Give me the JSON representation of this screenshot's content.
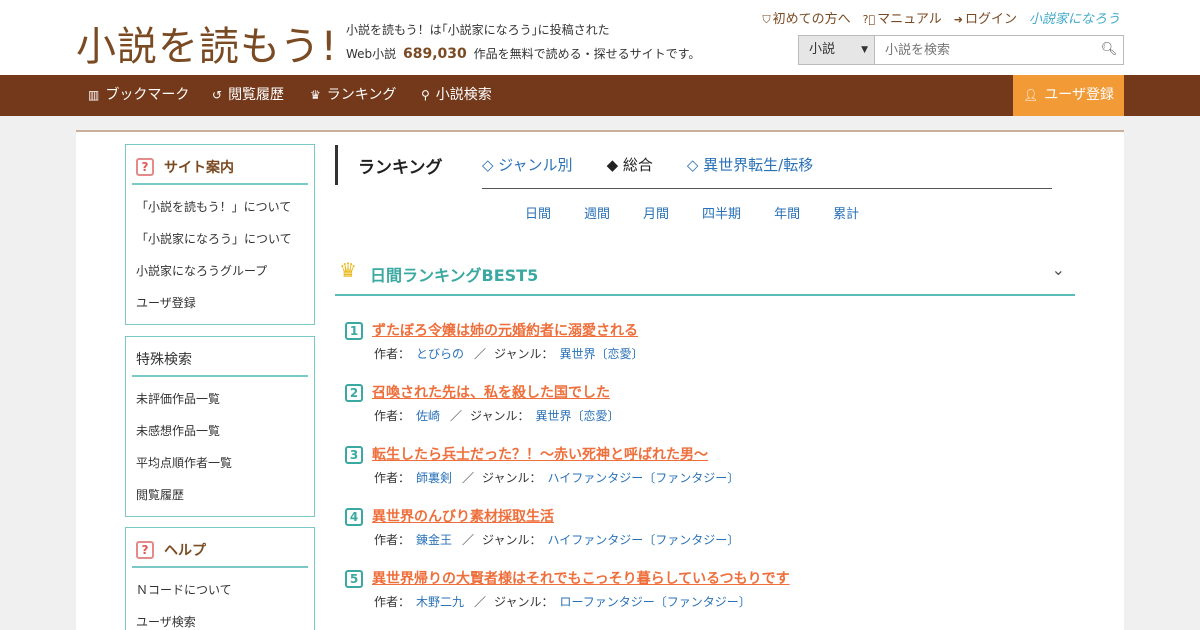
{
  "header": {
    "logo": "小説を読もう!",
    "tagline_line1": "小説を読もう！は｢小説家になろう｣に投稿された",
    "tagline_prefix": "Web小説",
    "tagline_count": "689,030",
    "tagline_suffix": "作品を無料で読める・探せるサイトです。",
    "links": {
      "first_time": "初めての方へ",
      "manual": "マニュアル",
      "login": "ログイン",
      "narou": "小説家になろう"
    },
    "search": {
      "select_value": "小説",
      "placeholder": "小説を検索"
    }
  },
  "nav": {
    "bookmark": "ブックマーク",
    "history": "閲覧履歴",
    "ranking": "ランキング",
    "search": "小説検索",
    "register": "ユーザ登録"
  },
  "sidebar": {
    "guide": {
      "title": "サイト案内",
      "items": [
        "「小説を読もう！」について",
        "「小説家になろう」について",
        "小説家になろうグループ",
        "ユーザ登録"
      ]
    },
    "special": {
      "title": "特殊検索",
      "items": [
        "未評価作品一覧",
        "未感想作品一覧",
        "平均点順作者一覧",
        "閲覧履歴"
      ]
    },
    "help": {
      "title": "ヘルプ",
      "items": [
        "Ｎコードについて",
        "ユーザ検索"
      ]
    }
  },
  "ranking": {
    "title": "ランキング",
    "tabs": [
      "◇ ジャンル別",
      "◆ 総合",
      "◇ 異世界転生/転移"
    ],
    "periods": [
      "日間",
      "週間",
      "月間",
      "四半期",
      "年間",
      "累計"
    ],
    "best_title": "日間ランキングBEST5",
    "author_label": "作者：",
    "genre_label": "ジャンル：",
    "separator": "／",
    "entries": [
      {
        "rank": "1",
        "title": "ずたぼろ令嬢は姉の元婚約者に溺愛される",
        "author": "とびらの",
        "genre": "異世界〔恋愛〕"
      },
      {
        "rank": "2",
        "title": "召喚された先は、私を殺した国でした",
        "author": "佐崎",
        "genre": "異世界〔恋愛〕"
      },
      {
        "rank": "3",
        "title": "転生したら兵士だった？！～赤い死神と呼ばれた男～",
        "author": "師裏剣",
        "genre": "ハイファンタジー〔ファンタジー〕"
      },
      {
        "rank": "4",
        "title": "異世界のんびり素材採取生活",
        "author": "錬金王",
        "genre": "ハイファンタジー〔ファンタジー〕"
      },
      {
        "rank": "5",
        "title": "異世界帰りの大賢者様はそれでもこっそり暮らしているつもりです",
        "author": "木野二九",
        "genre": "ローファンタジー〔ファンタジー〕"
      }
    ]
  }
}
